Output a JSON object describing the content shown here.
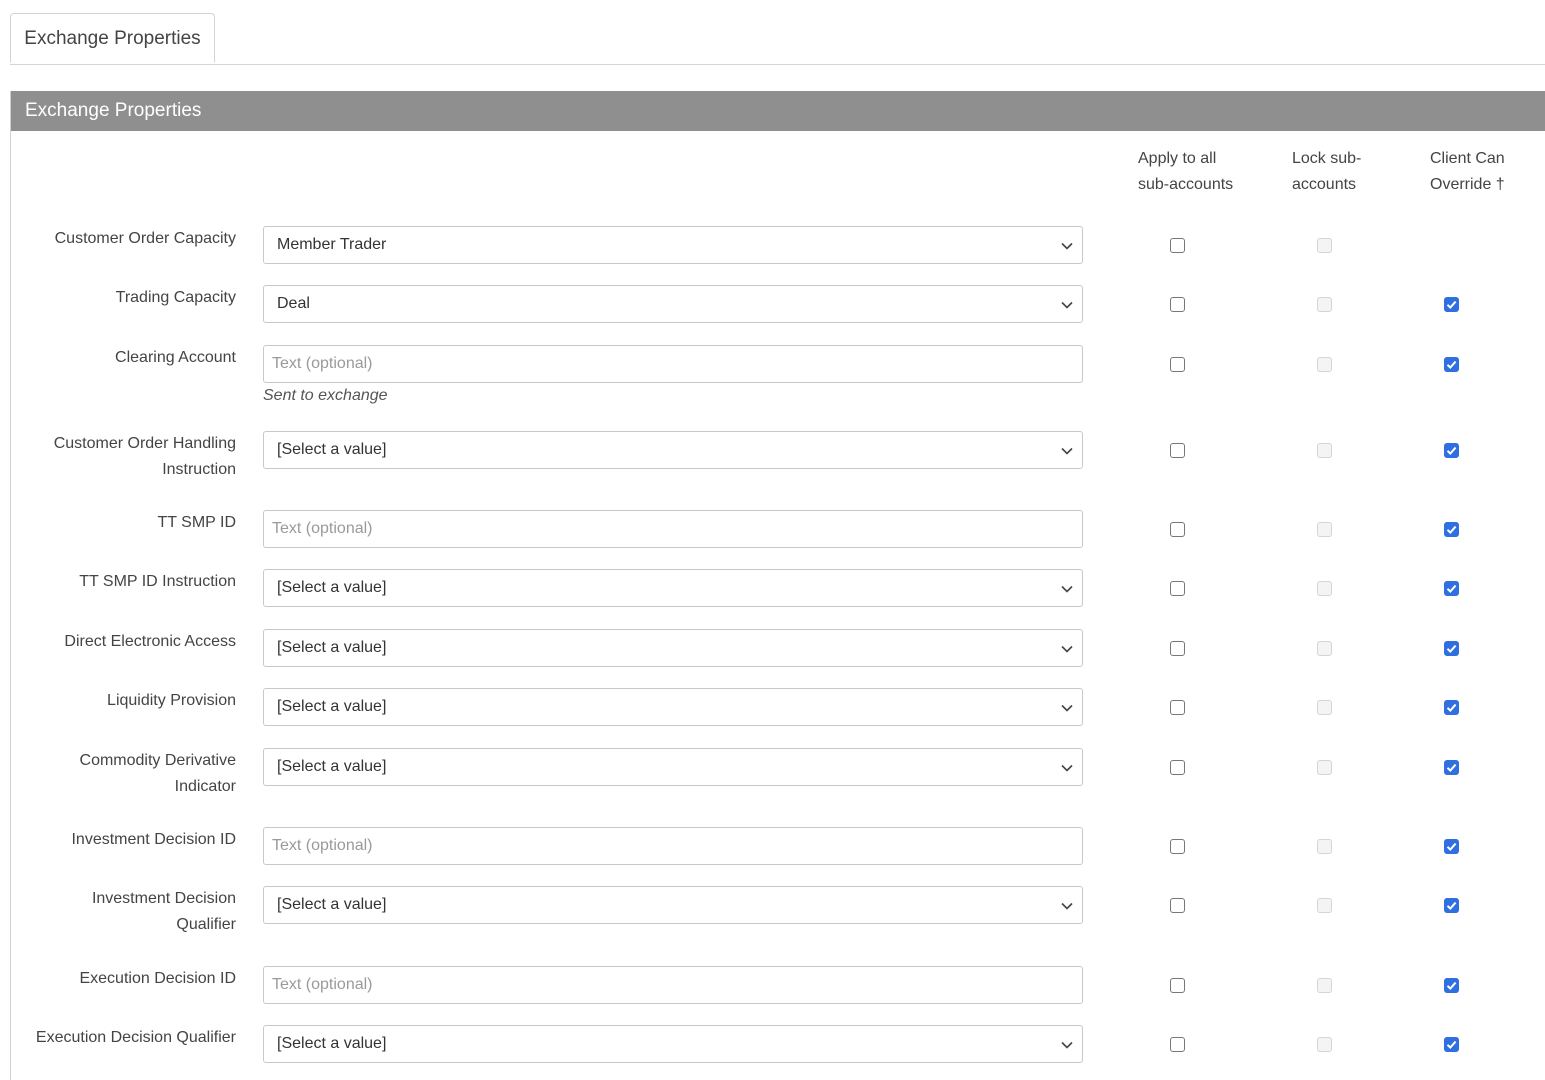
{
  "tab": {
    "label": "Exchange Properties"
  },
  "panel": {
    "title": "Exchange Properties"
  },
  "columns": {
    "apply_line1": "Apply to all",
    "apply_line2": "sub-accounts",
    "lock_line1": "Lock sub-",
    "lock_line2": "accounts",
    "override_line1": "Client Can",
    "override_line2": "Override †"
  },
  "rows": [
    {
      "label1": "Customer Order Capacity",
      "label2": "",
      "type": "select",
      "value": "Member Trader",
      "placeholder": "",
      "hint": "",
      "override": false
    },
    {
      "label1": "Trading Capacity",
      "label2": "",
      "type": "select",
      "value": "Deal",
      "placeholder": "",
      "hint": "",
      "override": true
    },
    {
      "label1": "Clearing Account",
      "label2": "",
      "type": "input",
      "value": "",
      "placeholder": "Text (optional)",
      "hint": "Sent to exchange",
      "override": true
    },
    {
      "label1": "Customer Order Handling",
      "label2": "Instruction",
      "type": "select",
      "value": "[Select a value]",
      "placeholder": "",
      "hint": "",
      "override": true
    },
    {
      "label1": "TT SMP ID",
      "label2": "",
      "type": "input",
      "value": "",
      "placeholder": "Text (optional)",
      "hint": "",
      "override": true
    },
    {
      "label1": "TT SMP ID Instruction",
      "label2": "",
      "type": "select",
      "value": "[Select a value]",
      "placeholder": "",
      "hint": "",
      "override": true
    },
    {
      "label1": "Direct Electronic Access",
      "label2": "",
      "type": "select",
      "value": "[Select a value]",
      "placeholder": "",
      "hint": "",
      "override": true
    },
    {
      "label1": "Liquidity Provision",
      "label2": "",
      "type": "select",
      "value": "[Select a value]",
      "placeholder": "",
      "hint": "",
      "override": true
    },
    {
      "label1": "Commodity Derivative",
      "label2": "Indicator",
      "type": "select",
      "value": "[Select a value]",
      "placeholder": "",
      "hint": "",
      "override": true
    },
    {
      "label1": "Investment Decision ID",
      "label2": "",
      "type": "input",
      "value": "",
      "placeholder": "Text (optional)",
      "hint": "",
      "override": true
    },
    {
      "label1": "Investment Decision",
      "label2": "Qualifier",
      "type": "select",
      "value": "[Select a value]",
      "placeholder": "",
      "hint": "",
      "override": true
    },
    {
      "label1": "Execution Decision ID",
      "label2": "",
      "type": "input",
      "value": "",
      "placeholder": "Text (optional)",
      "hint": "",
      "override": true
    },
    {
      "label1": "Execution Decision Qualifier",
      "label2": "",
      "type": "select",
      "value": "[Select a value]",
      "placeholder": "",
      "hint": "",
      "override": true
    }
  ],
  "colors": {
    "header_bg": "#8f8f8f",
    "checkbox_accent": "#2f6fe0"
  }
}
